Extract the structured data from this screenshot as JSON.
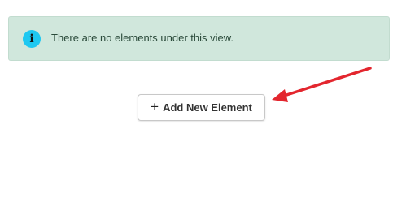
{
  "alert": {
    "icon": "info-icon",
    "icon_glyph": "i",
    "message": "There are no elements under this view."
  },
  "add_button": {
    "icon": "plus-icon",
    "icon_glyph": "+",
    "label": "Add New Element"
  },
  "annotation": {
    "icon": "red-arrow-icon",
    "color": "#e3262e"
  },
  "colors": {
    "alert_bg": "#d0e7dc",
    "info_icon": "#1ec8f1"
  }
}
